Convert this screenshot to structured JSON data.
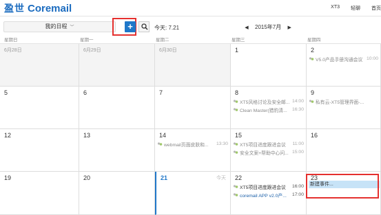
{
  "header": {
    "logo_cn": "盈世",
    "logo_en": "Coremail",
    "links": [
      "XT3",
      "轻聊",
      "首页"
    ]
  },
  "toolbar": {
    "calendar_select": "我的日程",
    "add_label": "+",
    "today_text": "今天: 7.21",
    "prev_arrow": "◀",
    "next_arrow": "▶",
    "month_title": "2015年7月"
  },
  "week_header": [
    "星期日",
    "星期一",
    "星期二",
    "星期三",
    "星期四"
  ],
  "weeks": [
    {
      "days": [
        {
          "label": "6月28日",
          "dim": true
        },
        {
          "label": "6月29日",
          "dim": true
        },
        {
          "label": "6月30日",
          "dim": true
        },
        {
          "label": "1"
        },
        {
          "label": "2",
          "events": [
            {
              "title": "V5.0产品手册沟通会议",
              "time": "10:00"
            }
          ]
        }
      ]
    },
    {
      "days": [
        {
          "label": "5"
        },
        {
          "label": "6"
        },
        {
          "label": "7"
        },
        {
          "label": "8",
          "events": [
            {
              "title": "XT5风格讨论及安全邮...",
              "time": "14:00"
            },
            {
              "title": "Clean Master(猎豹清...",
              "time": "16:30"
            }
          ]
        },
        {
          "label": "9",
          "events": [
            {
              "title": "私有云-XT5管理界面-...",
              "time": ""
            }
          ]
        }
      ]
    },
    {
      "days": [
        {
          "label": "12"
        },
        {
          "label": "13"
        },
        {
          "label": "14",
          "events": [
            {
              "title": "webmail页面皮肤和...",
              "time": "13:30"
            }
          ]
        },
        {
          "label": "15",
          "events": [
            {
              "title": "XT5项目进度跟进会议",
              "time": "11:00"
            },
            {
              "title": "安全文案+帮助中心问...",
              "time": "15:00"
            }
          ]
        },
        {
          "label": "16"
        }
      ]
    },
    {
      "days": [
        {
          "label": "19"
        },
        {
          "label": "20"
        },
        {
          "label": "21",
          "today": true,
          "today_label": "今天"
        },
        {
          "label": "22",
          "events": [
            {
              "title": "XT5项目进度跟进会议",
              "time": "16:00",
              "style": "dark"
            },
            {
              "title": "coremail APP v2.0产...",
              "time": "17:00",
              "style": "dark-blue"
            }
          ]
        },
        {
          "label": "23",
          "new_event": "新建事件..."
        }
      ]
    }
  ],
  "colors": {
    "accent": "#1f77c9",
    "highlight": "#e5302e",
    "new_event_bg": "#c7e3f7"
  }
}
